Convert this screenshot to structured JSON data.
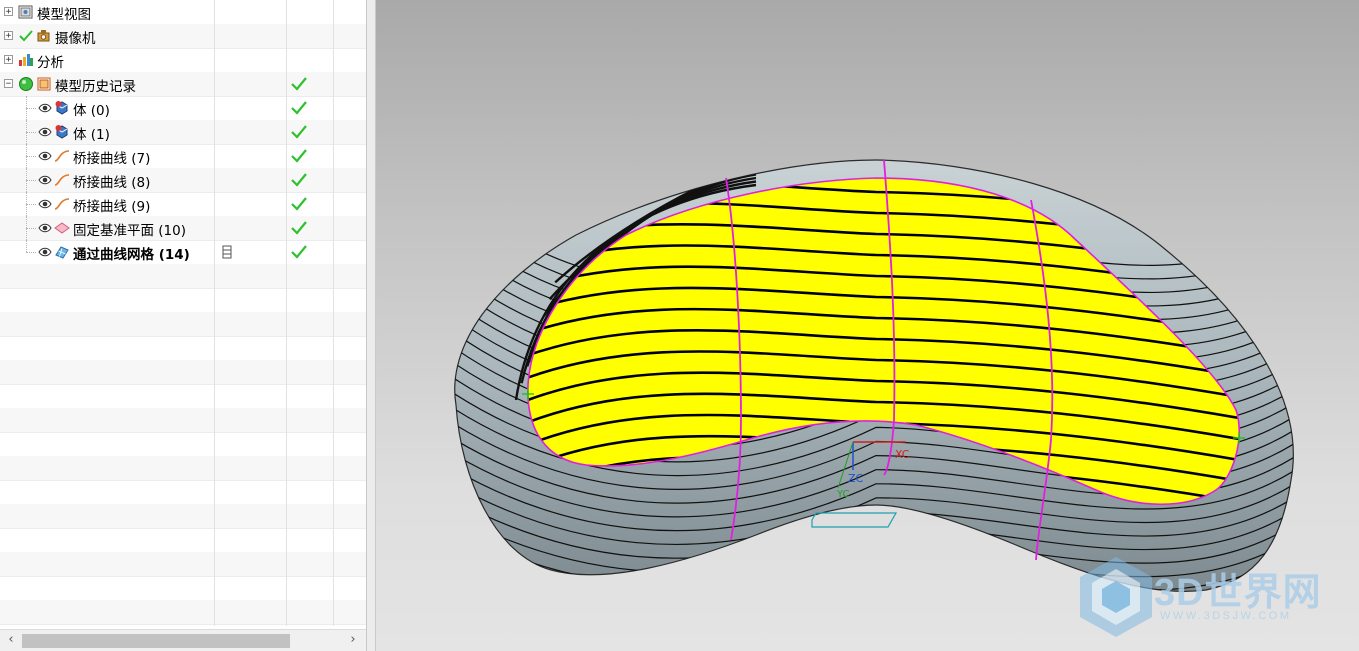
{
  "navigator": {
    "items": [
      {
        "label": "模型视图",
        "icon": "model-views-icon",
        "expander": "+",
        "check": false,
        "bold": false
      },
      {
        "label": "摄像机",
        "icon": "camera-icon",
        "expander": "+",
        "check": false,
        "bold": false
      },
      {
        "label": "分析",
        "icon": "analysis-icon",
        "expander": "+",
        "check": false,
        "bold": false
      },
      {
        "label": "模型历史记录",
        "icon": "model-history-icon",
        "expander": "−",
        "check": true,
        "bold": false
      },
      {
        "label": "体 (0)",
        "icon": "body-feature-icon",
        "check": true,
        "bold": false
      },
      {
        "label": "体 (1)",
        "icon": "body-feature-icon",
        "check": true,
        "bold": false
      },
      {
        "label": "桥接曲线 (7)",
        "icon": "bridge-curve-icon",
        "check": true,
        "bold": false
      },
      {
        "label": "桥接曲线 (8)",
        "icon": "bridge-curve-icon",
        "check": true,
        "bold": false
      },
      {
        "label": "桥接曲线 (9)",
        "icon": "bridge-curve-icon",
        "check": true,
        "bold": false
      },
      {
        "label": "固定基准平面 (10)",
        "icon": "datum-plane-icon",
        "check": true,
        "bold": false
      },
      {
        "label": "通过曲线网格 (14)",
        "icon": "curve-mesh-icon",
        "check": true,
        "bold": true
      }
    ],
    "scroll_left": "‹",
    "scroll_right": "›"
  },
  "viewport": {
    "axis_labels": {
      "x": "XC",
      "y": "YC",
      "z": "ZC"
    },
    "colors": {
      "face": "#ffff00",
      "edge": "#e020e0",
      "body": "#aab6bb",
      "background_top": "#a9a9a9",
      "background_bottom": "#e4e4e4"
    }
  },
  "watermark": {
    "title": "3D世界网",
    "url": "WWW.3DSJW.COM"
  }
}
